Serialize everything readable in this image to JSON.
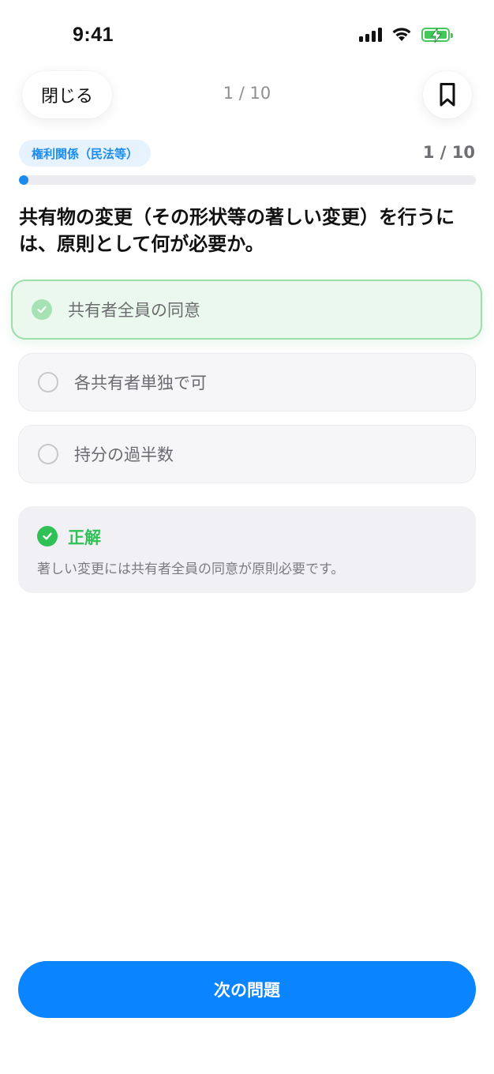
{
  "status_bar": {
    "time": "9:41"
  },
  "nav": {
    "close_label": "閉じる",
    "counter": "1 / 10"
  },
  "quiz": {
    "category": "権利関係（民法等）",
    "progress_text": "1 / 10",
    "progress_fraction": 0.012,
    "question": "共有物の変更（その形状等の著しい変更）を行うには、原則として何が必要か。",
    "options": [
      {
        "label": "共有者全員の同意",
        "state": "selected"
      },
      {
        "label": "各共有者単独で可",
        "state": "unselected"
      },
      {
        "label": "持分の過半数",
        "state": "unselected"
      }
    ]
  },
  "feedback": {
    "title": "正解",
    "body": "著しい変更には共有者全員の同意が原則必要です。"
  },
  "next_button_label": "次の問題",
  "colors": {
    "accent": "#0a84ff",
    "success": "#30c156",
    "tag_text": "#1a8cf0",
    "tag_bg": "#e6f2fe"
  }
}
